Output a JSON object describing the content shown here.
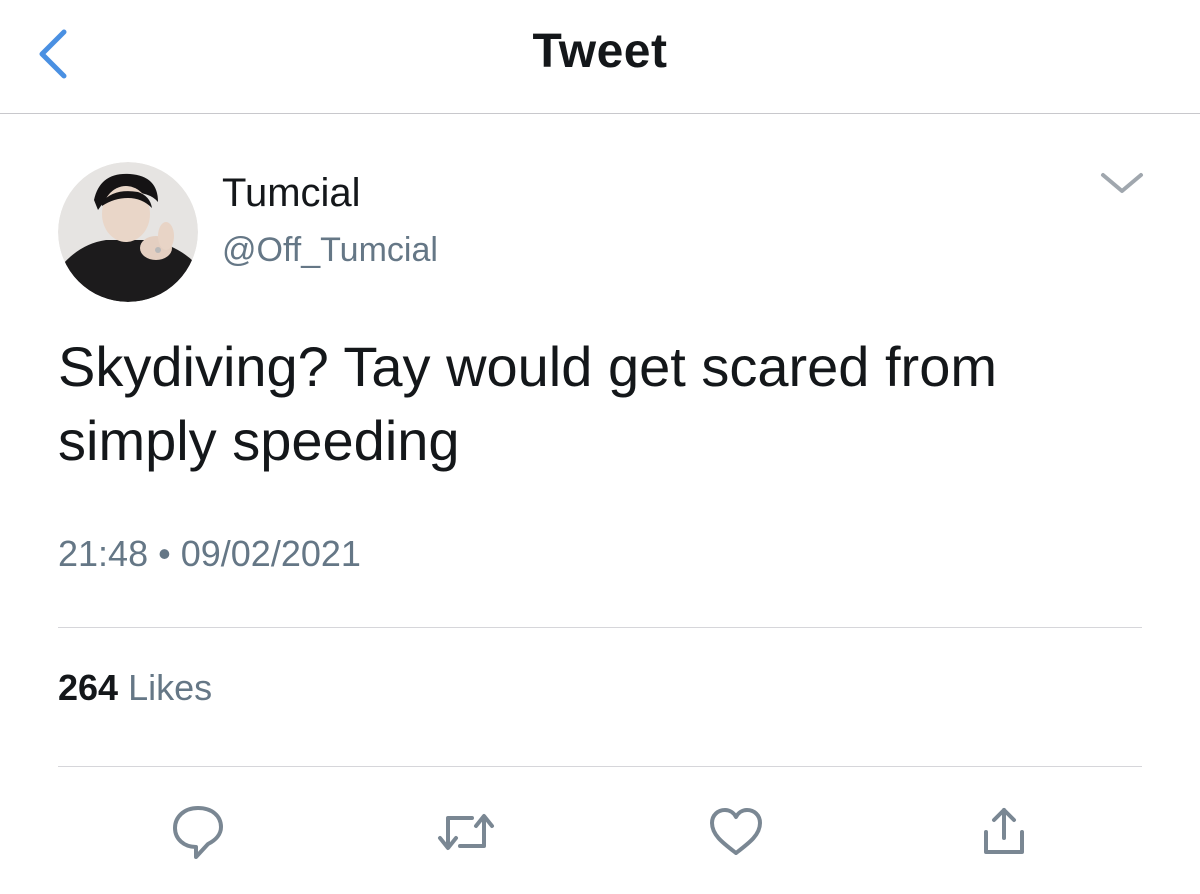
{
  "nav": {
    "title": "Tweet",
    "back_icon": "chevron-left-icon",
    "accent_color": "#4a90e2"
  },
  "tweet": {
    "author_name": "Tumcial",
    "author_handle": "@Off_Tumcial",
    "avatar_icon": "avatar",
    "more_icon": "chevron-down-icon",
    "text": "Skydiving? Tay would get scared from simply speeding",
    "time": "21:48",
    "separator": "•",
    "date": "09/02/2021",
    "likes_count": "264",
    "likes_label": "Likes"
  },
  "actions": [
    {
      "name": "reply",
      "icon": "comment-bubble-icon"
    },
    {
      "name": "retweet",
      "icon": "retweet-icon"
    },
    {
      "name": "like",
      "icon": "heart-icon"
    },
    {
      "name": "share",
      "icon": "share-icon"
    }
  ],
  "colors": {
    "text_primary": "#14171a",
    "text_secondary": "#657786",
    "icon_gray": "#7a8793",
    "divider": "#d6d6da"
  }
}
